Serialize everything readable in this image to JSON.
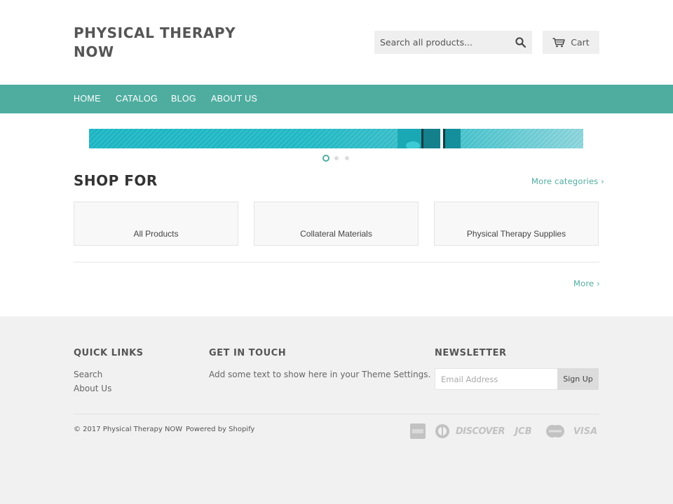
{
  "header": {
    "title": "PHYSICAL THERAPY NOW",
    "search_placeholder": "Search all products...",
    "search_icon": "search-icon",
    "cart_label": "Cart",
    "cart_icon": "cart-icon"
  },
  "nav": {
    "items": [
      {
        "label": "HOME"
      },
      {
        "label": "CATALOG"
      },
      {
        "label": "BLOG"
      },
      {
        "label": "ABOUT US"
      }
    ]
  },
  "slideshow": {
    "slide_count": 3,
    "active_index": 0
  },
  "shop": {
    "title": "SHOP FOR",
    "more_categories": "More categories ›",
    "categories": [
      {
        "label": "All Products"
      },
      {
        "label": "Collateral Materials"
      },
      {
        "label": "Physical Therapy Supplies"
      }
    ],
    "more": "More ›"
  },
  "footer": {
    "quick_links": {
      "heading": "QUICK LINKS",
      "items": [
        {
          "label": "Search"
        },
        {
          "label": "About Us"
        }
      ]
    },
    "get_in_touch": {
      "heading": "GET IN TOUCH",
      "text": "Add some text to show here in your Theme Settings."
    },
    "newsletter": {
      "heading": "NEWSLETTER",
      "placeholder": "Email Address",
      "button": "Sign Up"
    },
    "copyright": "© 2017 Physical Therapy NOW",
    "powered_by": "Powered by Shopify",
    "payment_icons": [
      "amex-icon",
      "diners-club-icon",
      "discover-icon",
      "jcb-icon",
      "mastercard-icon",
      "visa-icon"
    ],
    "payment_labels": {
      "discover": "DISCOVER",
      "jcb": "JCB",
      "visa": "VISA"
    }
  },
  "colors": {
    "accent": "#4fada0",
    "footer_bg": "#f1f1f1",
    "slide": "#24bdc9"
  }
}
